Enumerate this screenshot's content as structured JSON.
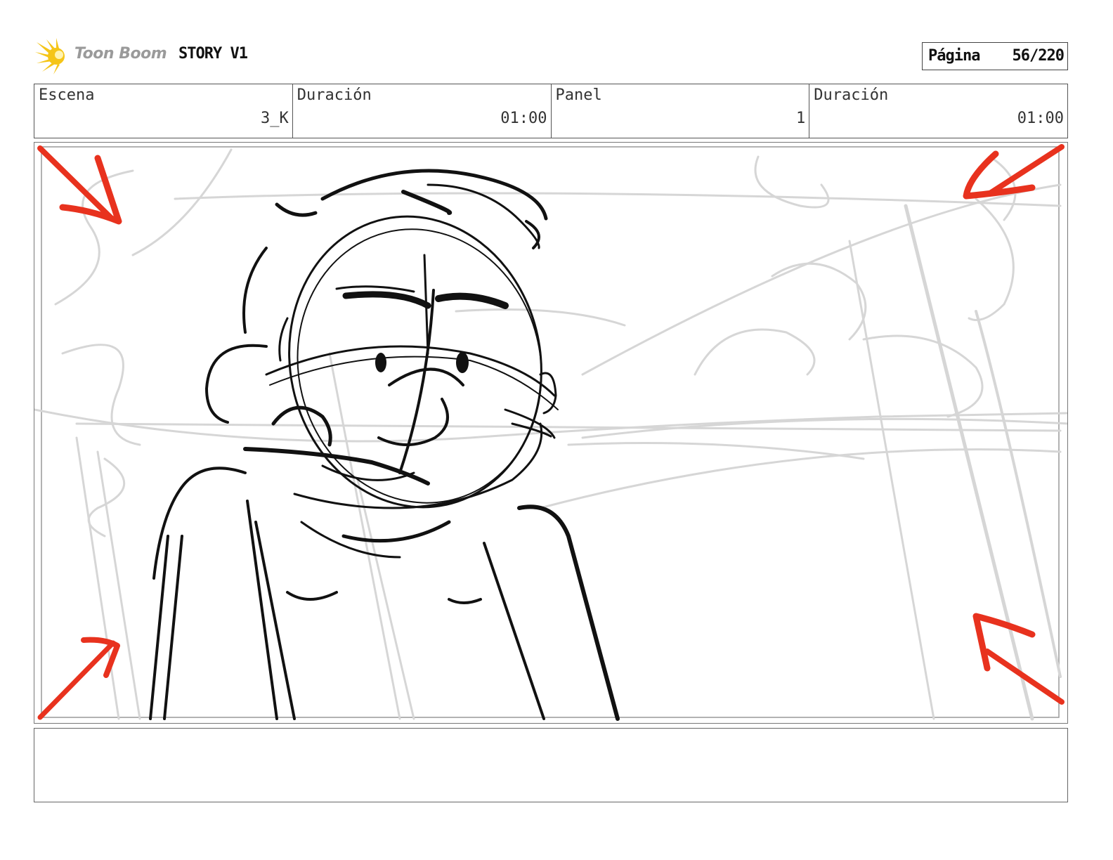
{
  "header": {
    "logo_text": "Toon Boom",
    "project_title": "STORY V1",
    "page_label": "Página",
    "page_value": "56/220"
  },
  "info": {
    "scene_label": "Escena",
    "scene_value": "3_K",
    "scene_duration_label": "Duración",
    "scene_duration_value": "01:00",
    "panel_label": "Panel",
    "panel_value": "1",
    "panel_duration_label": "Duración",
    "panel_duration_value": "01:00"
  },
  "notes": {
    "text": ""
  },
  "colors": {
    "arrow": "#e8321e",
    "sketch": "#111111",
    "rough": "#d6d6d6",
    "logo_sun": "#f5c518",
    "logo_text": "#9a9a9a"
  }
}
